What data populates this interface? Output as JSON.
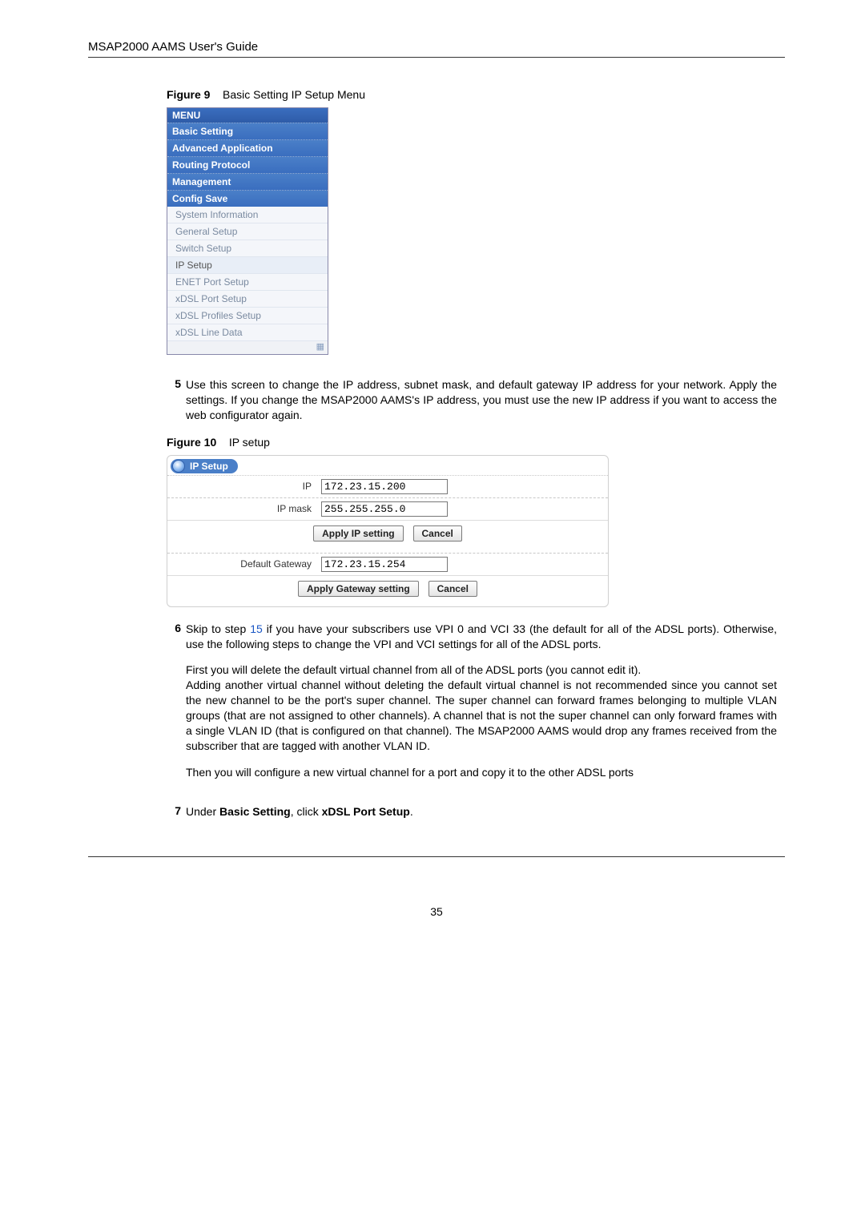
{
  "header": "MSAP2000 AAMS User's Guide",
  "figure9": {
    "label": "Figure 9",
    "caption": "Basic Setting IP Setup Menu",
    "menu_title": "MENU",
    "categories": [
      "Basic Setting",
      "Advanced Application",
      "Routing Protocol",
      "Management",
      "Config Save"
    ],
    "items": [
      "System Information",
      "General Setup",
      "Switch Setup",
      "IP Setup",
      "ENET Port Setup",
      "xDSL Port Setup",
      "xDSL Profiles Setup",
      "xDSL Line Data"
    ]
  },
  "step5": {
    "num": "5",
    "text": "Use this screen to change the IP address, subnet mask, and default gateway IP address for your network. Apply the settings. If you change the MSAP2000 AAMS's IP address, you must use the new IP address if you want to access the web configurator again."
  },
  "figure10": {
    "label": "Figure 10",
    "caption": "IP setup",
    "panel_title": "IP Setup",
    "ip_label": "IP",
    "ip_value": "172.23.15.200",
    "mask_label": "IP mask",
    "mask_value": "255.255.255.0",
    "apply_ip": "Apply IP setting",
    "cancel": "Cancel",
    "gw_label": "Default Gateway",
    "gw_value": "172.23.15.254",
    "apply_gw": "Apply Gateway setting"
  },
  "step6": {
    "num": "6",
    "lead_before_link": "Skip to step ",
    "link": "15",
    "lead_after_link": " if you have your subscribers use VPI 0 and VCI 33 (the default for all of the ADSL ports). Otherwise, use the following steps to change the VPI and VCI settings for all of the ADSL ports.",
    "p2": "First you will delete the default virtual channel from all of the ADSL ports (you cannot edit it).",
    "p3": "Adding another virtual channel without deleting the default virtual channel is not recommended since you cannot set the new channel to be the port's super channel. The super channel can forward frames belonging to multiple VLAN groups (that are not assigned to other channels).   A channel that is not the super channel can only forward frames with a single VLAN ID (that is configured on that channel). The MSAP2000 AAMS would drop any frames received from the subscriber that are tagged with another VLAN ID.",
    "p4": "Then you will configure a new virtual channel for a port and copy it to the other ADSL ports"
  },
  "step7": {
    "num": "7",
    "before1": "Under ",
    "bold1": "Basic Setting",
    "mid": ", click ",
    "bold2": "xDSL Port Setup",
    "after": "."
  },
  "page_number": "35"
}
